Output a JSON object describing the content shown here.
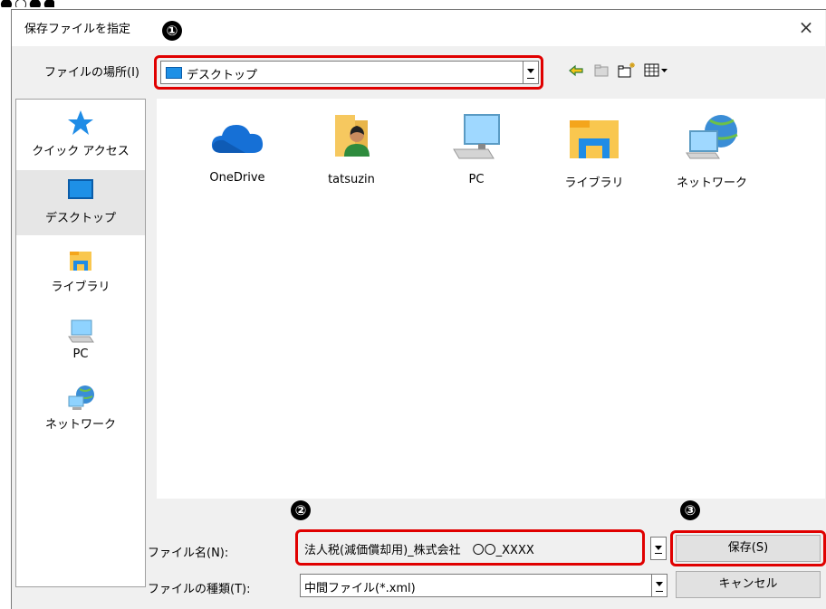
{
  "dialog": {
    "title": "保存ファイルを指定",
    "close_glyph": "×"
  },
  "toolbar": {
    "location_label": "ファイルの場所(I)",
    "location_value": "デスクトップ",
    "icons": [
      "back-icon",
      "up-folder-icon",
      "new-folder-icon",
      "view-menu-icon"
    ]
  },
  "sidebar": {
    "items": [
      {
        "label": "クイック アクセス",
        "icon": "star-icon"
      },
      {
        "label": "デスクトップ",
        "icon": "desktop-icon",
        "selected": true
      },
      {
        "label": "ライブラリ",
        "icon": "library-icon"
      },
      {
        "label": "PC",
        "icon": "pc-icon"
      },
      {
        "label": "ネットワーク",
        "icon": "network-icon"
      }
    ]
  },
  "files": [
    {
      "label": "OneDrive",
      "icon": "onedrive-icon"
    },
    {
      "label": "tatsuzin",
      "icon": "user-folder-icon"
    },
    {
      "label": "PC",
      "icon": "pc-icon"
    },
    {
      "label": "ライブラリ",
      "icon": "library-icon"
    },
    {
      "label": "ネットワーク",
      "icon": "network-icon"
    }
  ],
  "form": {
    "filename_label": "ファイル名(N):",
    "filename_value": "法人税(減価償却用)_株式会社　〇〇_XXXX",
    "filetype_label": "ファイルの種類(T):",
    "filetype_value": "中間ファイル(*.xml)"
  },
  "buttons": {
    "save": "保存(S)",
    "cancel": "キャンセル"
  },
  "annotations": {
    "one": "①",
    "two": "②",
    "three": "③",
    "highlight_color": "#e00000"
  }
}
